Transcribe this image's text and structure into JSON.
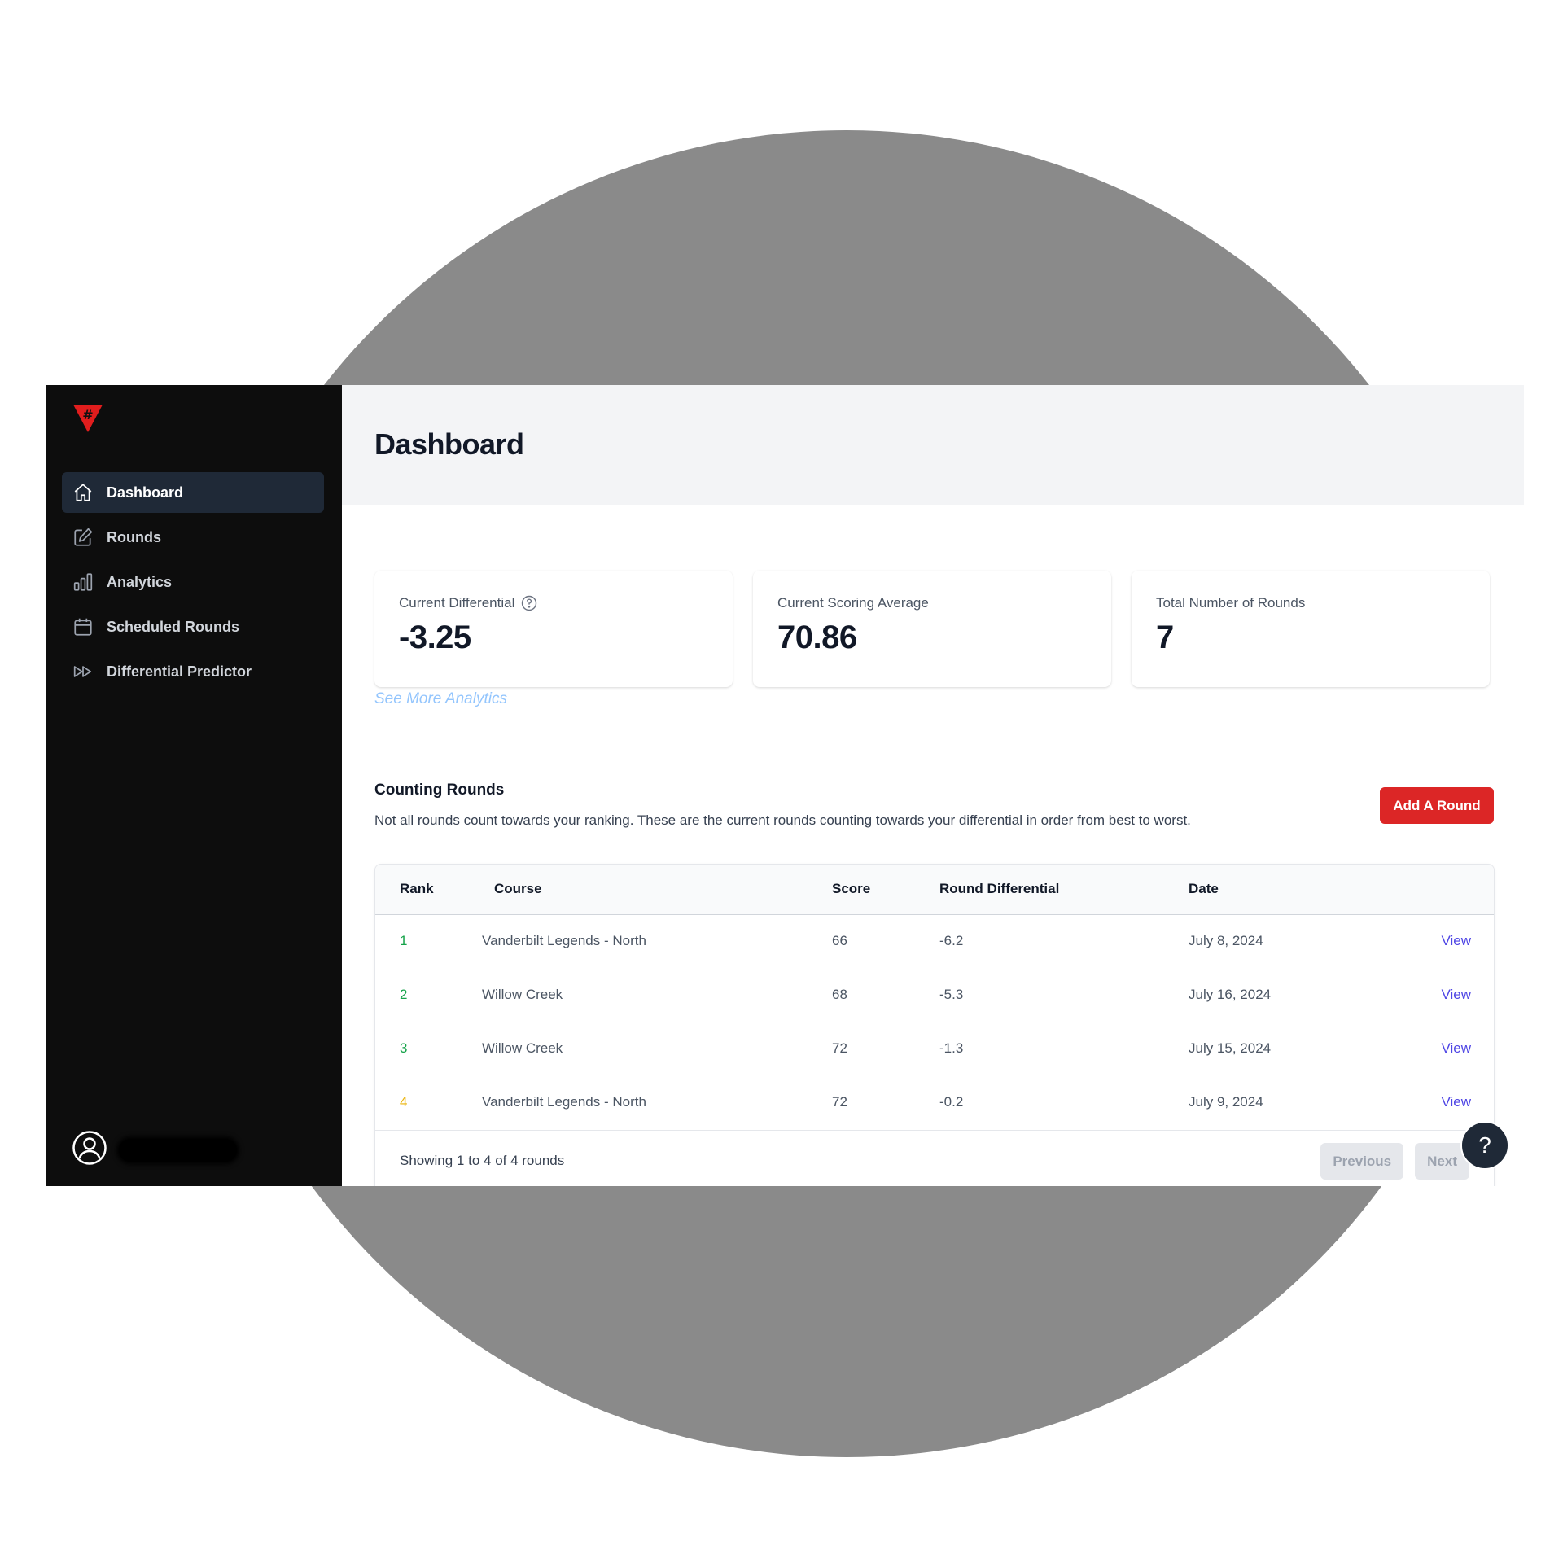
{
  "colors": {
    "sidebar_bg": "#0d0d0d",
    "active_nav_bg": "#1f2937",
    "accent_red": "#dc2626",
    "link_blue": "#93c5fd",
    "view_link": "#4f46e5",
    "rank_green": "#16a34a",
    "rank_yellow": "#eab308"
  },
  "sidebar": {
    "logo_icon": "red-triangle-hash-logo",
    "items": [
      {
        "label": "Dashboard",
        "icon": "home-icon",
        "active": true
      },
      {
        "label": "Rounds",
        "icon": "pencil-square-icon",
        "active": false
      },
      {
        "label": "Analytics",
        "icon": "bar-chart-icon",
        "active": false
      },
      {
        "label": "Scheduled Rounds",
        "icon": "calendar-icon",
        "active": false
      },
      {
        "label": "Differential Predictor",
        "icon": "fast-forward-icon",
        "active": false
      }
    ],
    "user": {
      "avatar_icon": "user-circle-icon"
    }
  },
  "header": {
    "title": "Dashboard"
  },
  "stats": [
    {
      "label": "Current Differential",
      "value": "-3.25",
      "help_icon": "question-circle-icon"
    },
    {
      "label": "Current Scoring Average",
      "value": "70.86"
    },
    {
      "label": "Total Number of Rounds",
      "value": "7"
    }
  ],
  "see_more_link": "See More Analytics",
  "counting_rounds": {
    "title": "Counting Rounds",
    "description": "Not all rounds count towards your ranking. These are the current rounds counting towards your differential in order from best to worst.",
    "add_button": "Add A Round",
    "columns": [
      "Rank",
      "Course",
      "Score",
      "Round Differential",
      "Date",
      ""
    ],
    "rows": [
      {
        "rank": "1",
        "course": "Vanderbilt Legends - North",
        "score": "66",
        "differential": "-6.2",
        "date": "July 8, 2024",
        "action": "View",
        "rank_color": "green"
      },
      {
        "rank": "2",
        "course": "Willow Creek",
        "score": "68",
        "differential": "-5.3",
        "date": "July 16, 2024",
        "action": "View",
        "rank_color": "green"
      },
      {
        "rank": "3",
        "course": "Willow Creek",
        "score": "72",
        "differential": "-1.3",
        "date": "July 15, 2024",
        "action": "View",
        "rank_color": "green"
      },
      {
        "rank": "4",
        "course": "Vanderbilt Legends - North",
        "score": "72",
        "differential": "-0.2",
        "date": "July 9, 2024",
        "action": "View",
        "rank_color": "yellow"
      }
    ],
    "footer": {
      "showing_text": "Showing 1 to 4 of 4 rounds",
      "previous": "Previous",
      "next": "Next"
    }
  },
  "help_fab": "?"
}
